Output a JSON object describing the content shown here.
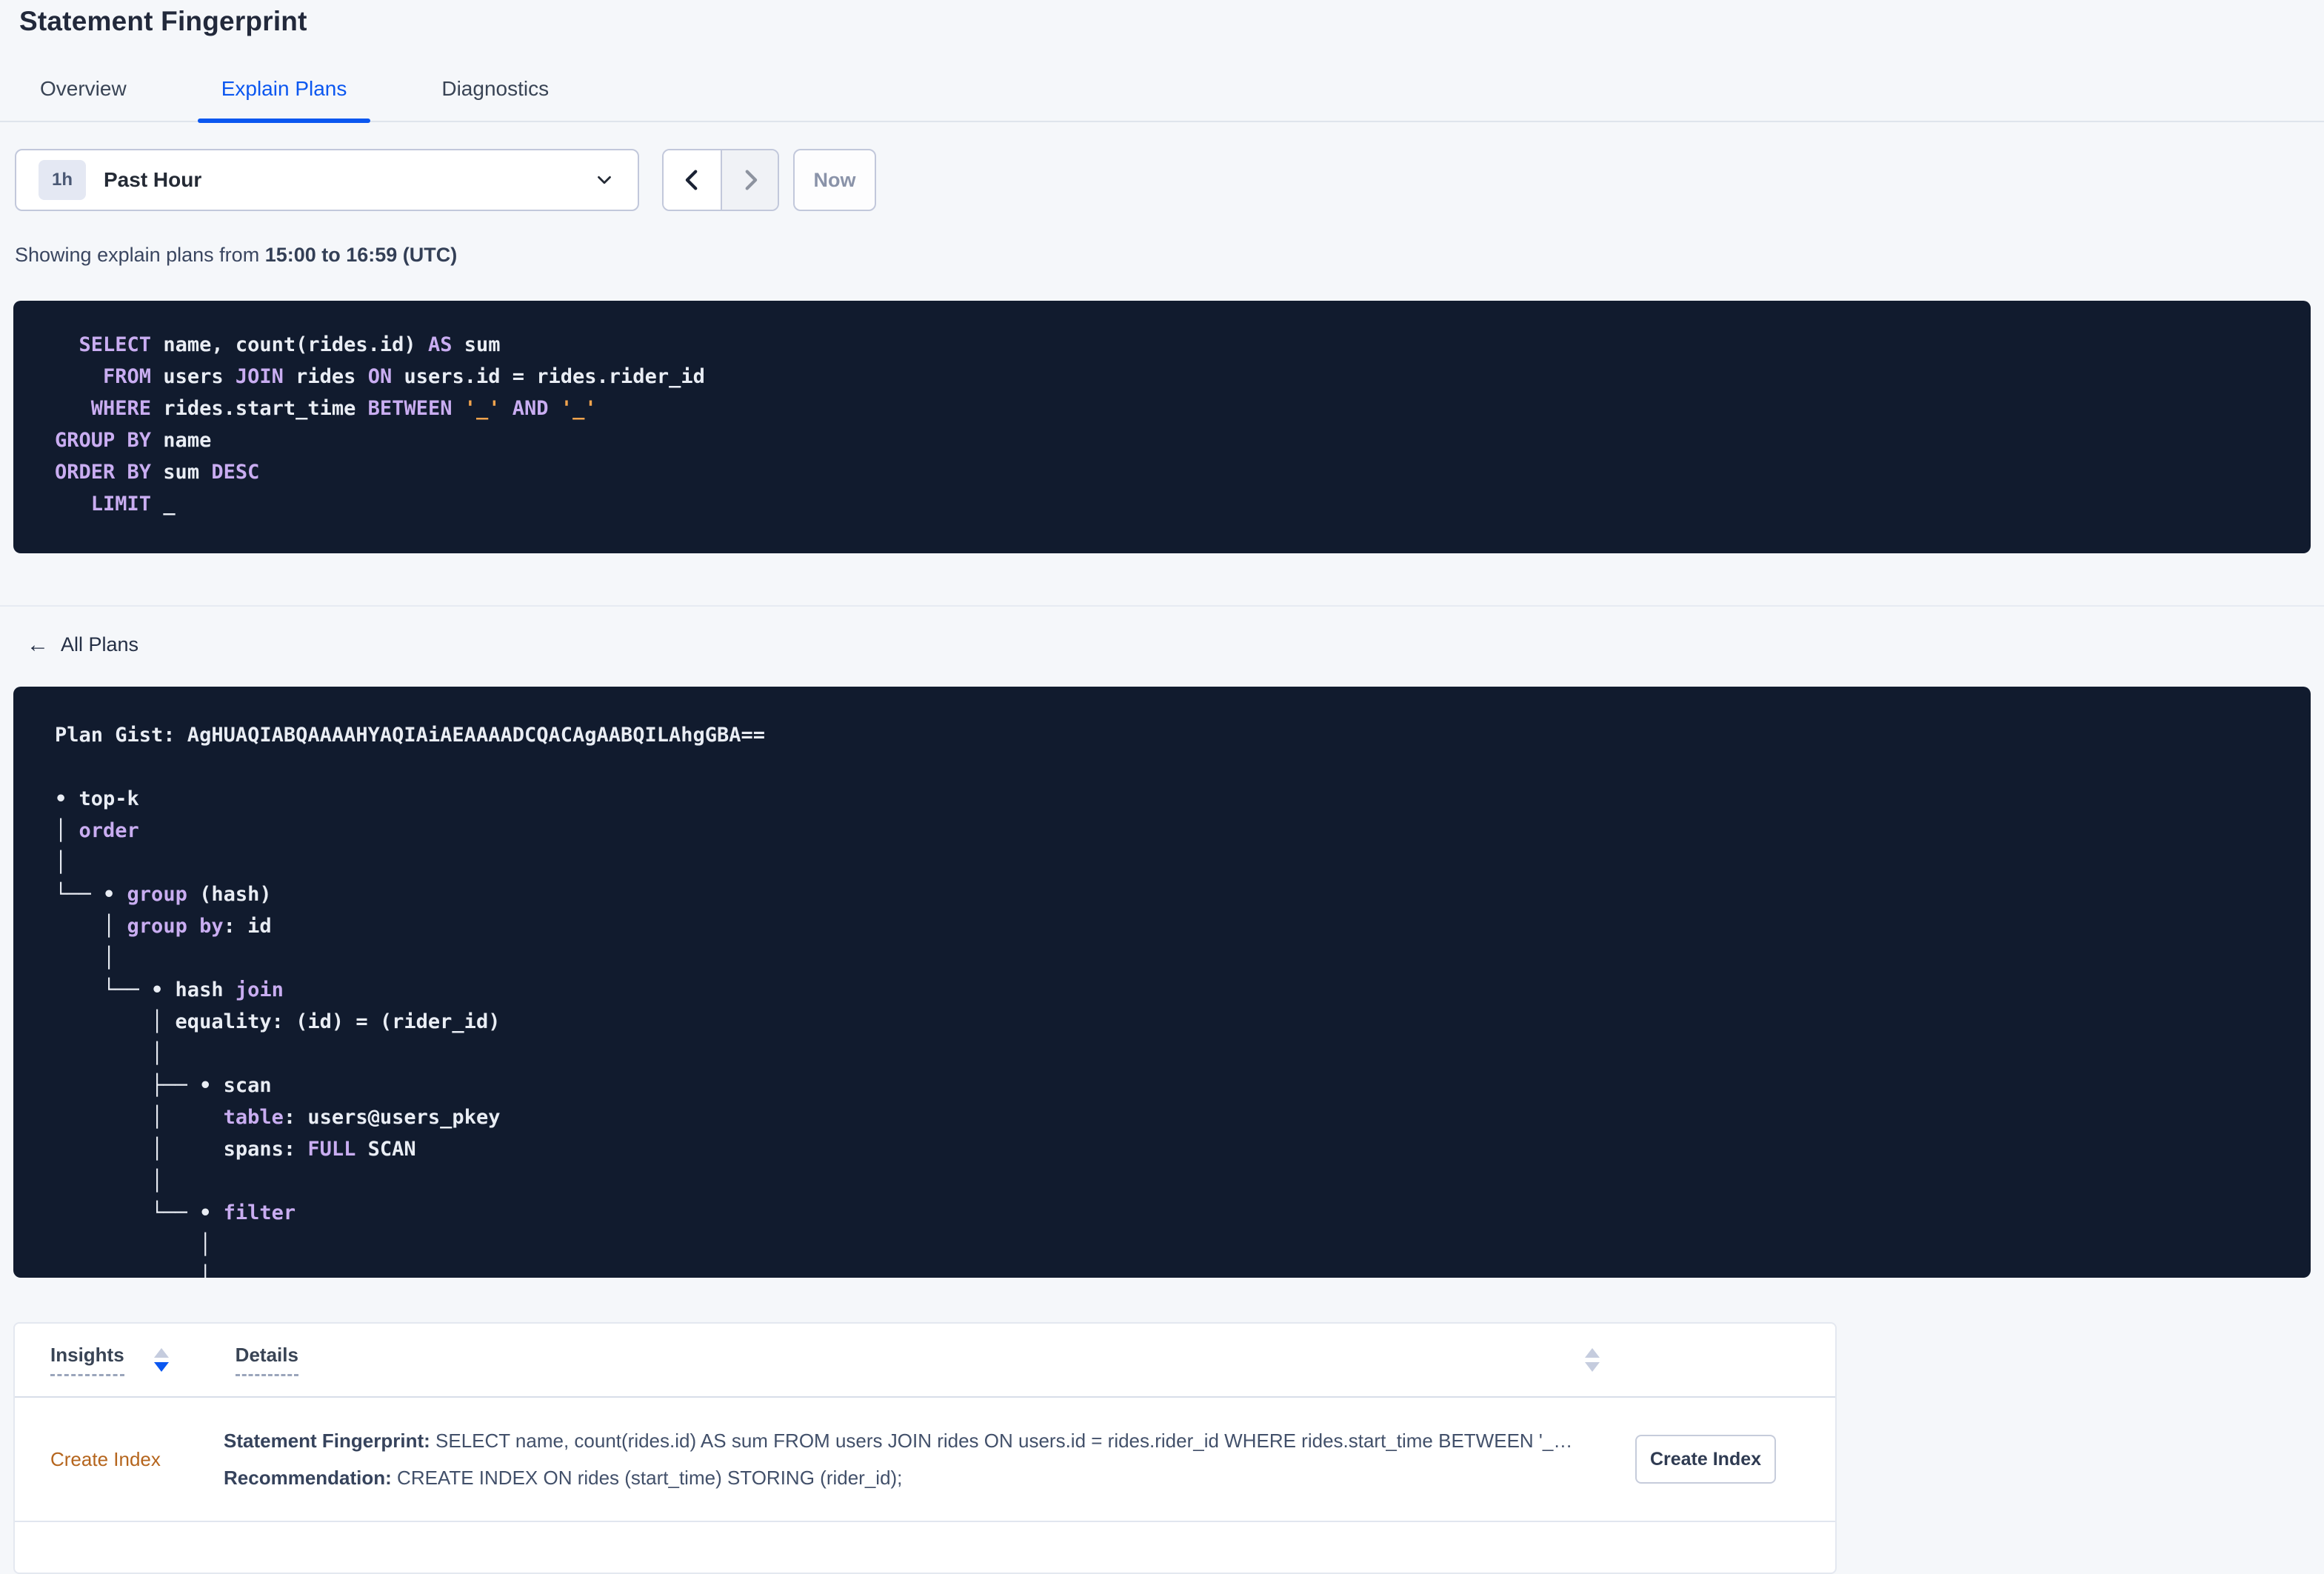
{
  "page_title": "Statement Fingerprint",
  "tabs": [
    {
      "label": "Overview",
      "active": false
    },
    {
      "label": "Explain Plans",
      "active": true
    },
    {
      "label": "Diagnostics",
      "active": false
    }
  ],
  "time_picker": {
    "badge": "1h",
    "selected": "Past Hour",
    "now_label": "Now"
  },
  "showing": {
    "prefix": "Showing explain plans from ",
    "range_bold": "15:00 to 16:59 (UTC)"
  },
  "colors": {
    "accent_blue": "#0B57F0",
    "code_background": "#111B2E",
    "keyword_purple": "#C9ADF1",
    "code_white": "#E9EDF4",
    "placeholder_orange": "#F2A44D",
    "insight_orange": "#B5651D"
  },
  "sql": {
    "lines": [
      [
        {
          "c": "w",
          "t": "  "
        },
        {
          "c": "k",
          "t": "SELECT"
        },
        {
          "c": "w",
          "t": " name, count(rides.id) "
        },
        {
          "c": "k",
          "t": "AS"
        },
        {
          "c": "w",
          "t": " sum"
        }
      ],
      [
        {
          "c": "w",
          "t": "    "
        },
        {
          "c": "k",
          "t": "FROM"
        },
        {
          "c": "w",
          "t": " users "
        },
        {
          "c": "k",
          "t": "JOIN"
        },
        {
          "c": "w",
          "t": " rides "
        },
        {
          "c": "k",
          "t": "ON"
        },
        {
          "c": "w",
          "t": " users.id = rides.rider_id"
        }
      ],
      [
        {
          "c": "w",
          "t": "   "
        },
        {
          "c": "k",
          "t": "WHERE"
        },
        {
          "c": "w",
          "t": " rides.start_time "
        },
        {
          "c": "k",
          "t": "BETWEEN"
        },
        {
          "c": "w",
          "t": " "
        },
        {
          "c": "o",
          "t": "'_'"
        },
        {
          "c": "w",
          "t": " "
        },
        {
          "c": "k",
          "t": "AND"
        },
        {
          "c": "w",
          "t": " "
        },
        {
          "c": "o",
          "t": "'_'"
        }
      ],
      [
        {
          "c": "k",
          "t": "GROUP BY"
        },
        {
          "c": "w",
          "t": " name"
        }
      ],
      [
        {
          "c": "k",
          "t": "ORDER BY"
        },
        {
          "c": "w",
          "t": " sum "
        },
        {
          "c": "k",
          "t": "DESC"
        }
      ],
      [
        {
          "c": "w",
          "t": "   "
        },
        {
          "c": "k",
          "t": "LIMIT"
        },
        {
          "c": "w",
          "t": " _"
        }
      ]
    ]
  },
  "all_plans_label": "All Plans",
  "plan": {
    "gist_label": "Plan Gist: ",
    "gist": "AgHUAQIABQAAAAHYAQIAiAEAAAADCQACAgAABQILAhgGBA==",
    "tree": [
      [
        {
          "c": "w",
          "t": "• top-k"
        }
      ],
      [
        {
          "c": "w",
          "t": "│ "
        },
        {
          "c": "k",
          "t": "order"
        }
      ],
      [
        {
          "c": "w",
          "t": "│"
        }
      ],
      [
        {
          "c": "w",
          "t": "└── • "
        },
        {
          "c": "k",
          "t": "group"
        },
        {
          "c": "w",
          "t": " (hash)"
        }
      ],
      [
        {
          "c": "w",
          "t": "    │ "
        },
        {
          "c": "k",
          "t": "group by"
        },
        {
          "c": "w",
          "t": ": id"
        }
      ],
      [
        {
          "c": "w",
          "t": "    │"
        }
      ],
      [
        {
          "c": "w",
          "t": "    └── • hash "
        },
        {
          "c": "k",
          "t": "join"
        }
      ],
      [
        {
          "c": "w",
          "t": "        │ equality: (id) = (rider_id)"
        }
      ],
      [
        {
          "c": "w",
          "t": "        │"
        }
      ],
      [
        {
          "c": "w",
          "t": "        ├── • scan"
        }
      ],
      [
        {
          "c": "w",
          "t": "        │     "
        },
        {
          "c": "k",
          "t": "table"
        },
        {
          "c": "w",
          "t": ": users@users_pkey"
        }
      ],
      [
        {
          "c": "w",
          "t": "        │     spans: "
        },
        {
          "c": "k",
          "t": "FULL"
        },
        {
          "c": "w",
          "t": " SCAN"
        }
      ],
      [
        {
          "c": "w",
          "t": "        │"
        }
      ],
      [
        {
          "c": "w",
          "t": "        └── • "
        },
        {
          "c": "k",
          "t": "filter"
        }
      ],
      [
        {
          "c": "w",
          "t": "            │"
        }
      ],
      [
        {
          "c": "w",
          "t": "            │"
        }
      ]
    ]
  },
  "insights_table": {
    "columns": [
      "Insights",
      "Details"
    ],
    "row": {
      "insight": "Create Index",
      "line1_label": "Statement Fingerprint:",
      "line1_text": " SELECT name, count(rides.id) AS sum FROM users JOIN rides ON users.id = rides.rider_id WHERE rides.start_time BETWEEN '_…",
      "line2_label": "Recommendation:",
      "line2_text": " CREATE INDEX ON rides (start_time) STORING (rider_id);",
      "button_label": "Create Index"
    }
  }
}
